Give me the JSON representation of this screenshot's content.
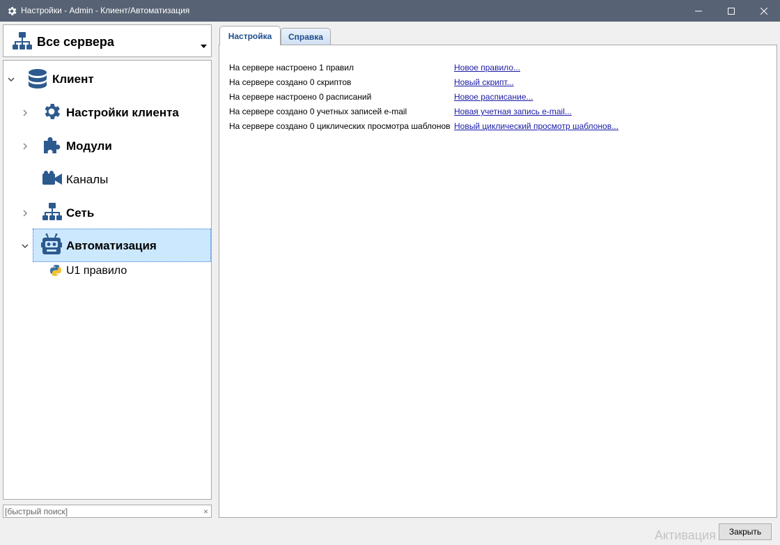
{
  "window": {
    "title": "Настройки - Admin - Клиент/Автоматизация"
  },
  "server_selector": {
    "label": "Все сервера",
    "icon": "network-icon"
  },
  "tree": {
    "items": [
      {
        "label": "Клиент",
        "icon": "database-icon",
        "expanded": true
      },
      {
        "label": "Настройки клиента",
        "icon": "gear-icon"
      },
      {
        "label": "Модули",
        "icon": "puzzle-icon"
      },
      {
        "label": "Каналы",
        "icon": "camera-icon"
      },
      {
        "label": "Сеть",
        "icon": "network-icon"
      },
      {
        "label": "Автоматизация",
        "icon": "robot-icon",
        "selected": true,
        "expanded": true
      },
      {
        "label": "U1 правило",
        "icon": "python-icon"
      }
    ]
  },
  "search": {
    "placeholder": "[быстрый поиск]",
    "clear": "×"
  },
  "tabs": [
    {
      "label": "Настройка",
      "active": true
    },
    {
      "label": "Справка",
      "active": false
    }
  ],
  "summary": [
    {
      "text": "На сервере настроено 1 правил",
      "link": "Новое правило..."
    },
    {
      "text": "На сервере создано 0 скриптов",
      "link": "Новый скрипт..."
    },
    {
      "text": "На сервере настроено 0 расписаний",
      "link": "Новое расписание..."
    },
    {
      "text": "На сервере создано 0 учетных записей e-mail",
      "link": "Новая учетная запись e-mail..."
    },
    {
      "text": "На сервере создано 0 циклических просмотра шаблонов",
      "link": "Новый циклический просмотр шаблонов..."
    }
  ],
  "footer": {
    "close_label": "Закрыть",
    "watermark": "Активация Windows"
  },
  "colors": {
    "titlebar": "#576374",
    "icon_blue": "#2d5a8e",
    "selection": "#cce8ff",
    "link": "#1a1aa6"
  }
}
